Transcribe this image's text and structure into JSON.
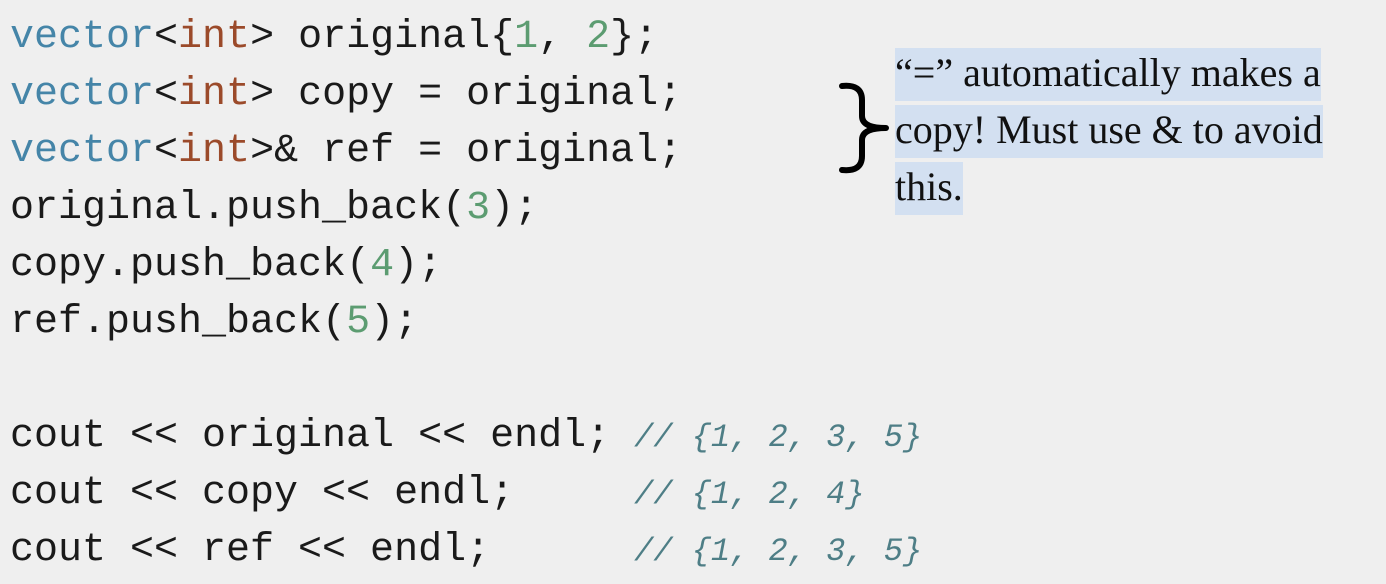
{
  "colors": {
    "background": "#efefef",
    "type": "#4585a8",
    "keyword": "#9b4a2a",
    "number": "#5c9c71",
    "plain": "#1a1a1a",
    "comment": "#4e7e86",
    "callout_highlight": "#d3e0f1"
  },
  "code": [
    {
      "id": "l1",
      "tokens": [
        {
          "t": "vector",
          "c": "type"
        },
        {
          "t": "<",
          "c": "plain"
        },
        {
          "t": "int",
          "c": "kw"
        },
        {
          "t": "> original{",
          "c": "plain"
        },
        {
          "t": "1",
          "c": "num"
        },
        {
          "t": ", ",
          "c": "plain"
        },
        {
          "t": "2",
          "c": "num"
        },
        {
          "t": "};",
          "c": "plain"
        }
      ]
    },
    {
      "id": "l2",
      "tokens": [
        {
          "t": "vector",
          "c": "type"
        },
        {
          "t": "<",
          "c": "plain"
        },
        {
          "t": "int",
          "c": "kw"
        },
        {
          "t": "> copy = original;",
          "c": "plain"
        }
      ]
    },
    {
      "id": "l3",
      "tokens": [
        {
          "t": "vector",
          "c": "type"
        },
        {
          "t": "<",
          "c": "plain"
        },
        {
          "t": "int",
          "c": "kw"
        },
        {
          "t": ">& ref = original;",
          "c": "plain"
        }
      ]
    },
    {
      "id": "l4",
      "tokens": [
        {
          "t": "original.push_back(",
          "c": "plain"
        },
        {
          "t": "3",
          "c": "num"
        },
        {
          "t": ");",
          "c": "plain"
        }
      ]
    },
    {
      "id": "l5",
      "tokens": [
        {
          "t": "copy.push_back(",
          "c": "plain"
        },
        {
          "t": "4",
          "c": "num"
        },
        {
          "t": ");",
          "c": "plain"
        }
      ]
    },
    {
      "id": "l6",
      "tokens": [
        {
          "t": "ref.push_back(",
          "c": "plain"
        },
        {
          "t": "5",
          "c": "num"
        },
        {
          "t": ");",
          "c": "plain"
        }
      ]
    },
    {
      "id": "l7",
      "tokens": [
        {
          "t": "cout << original << endl; ",
          "c": "plain"
        },
        {
          "t": "// {1, 2, 3, 5}",
          "c": "cm"
        }
      ]
    },
    {
      "id": "l8",
      "tokens": [
        {
          "t": "cout << copy << endl;     ",
          "c": "plain"
        },
        {
          "t": "// {1, 2, 4}",
          "c": "cm"
        }
      ]
    },
    {
      "id": "l9",
      "tokens": [
        {
          "t": "cout << ref << endl;      ",
          "c": "plain"
        },
        {
          "t": "// {1, 2, 3, 5}",
          "c": "cm"
        }
      ]
    }
  ],
  "callout": {
    "text": "“=” automatically makes a copy! Must use & to avoid this."
  }
}
